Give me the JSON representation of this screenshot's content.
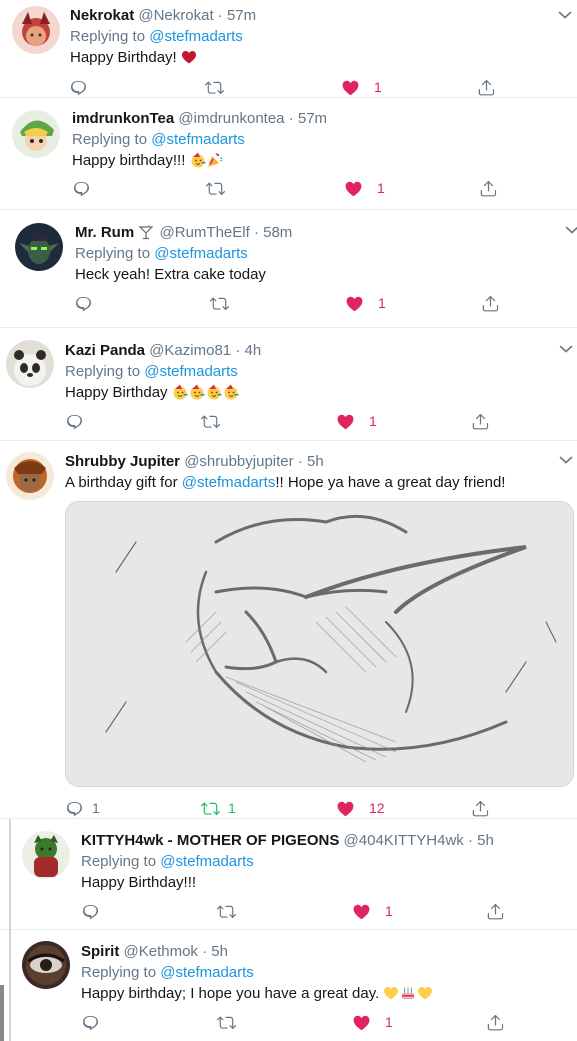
{
  "tweets": [
    {
      "name": "Nekrokat",
      "handle": "@Nekrokat",
      "sep": "·",
      "time": "57m",
      "reply_prefix": "Replying to",
      "reply_to": "@stefmadarts",
      "text": "Happy Birthday!",
      "emoji": [
        "red-heart"
      ],
      "avatar": "nekrokat-avatar",
      "likes": "1",
      "replies": "",
      "retweets": ""
    },
    {
      "name": "imdrunkonTea",
      "handle": "@imdrunkontea",
      "sep": "·",
      "time": "57m",
      "reply_prefix": "Replying to",
      "reply_to": "@stefmadarts",
      "text": "Happy birthday!!!",
      "emoji": [
        "partying-face",
        "party-popper"
      ],
      "avatar": "imdrunkontea-avatar",
      "likes": "1",
      "replies": "",
      "retweets": ""
    },
    {
      "name": "Mr. Rum",
      "name_emoji": "cocktail",
      "handle": "@RumTheElf",
      "sep": "·",
      "time": "58m",
      "reply_prefix": "Replying to",
      "reply_to": "@stefmadarts",
      "text": "Heck yeah! Extra cake today",
      "avatar": "mr-rum-avatar",
      "likes": "1",
      "replies": "",
      "retweets": ""
    },
    {
      "name": "Kazi Panda",
      "handle": "@Kazimo81",
      "sep": "·",
      "time": "4h",
      "reply_prefix": "Replying to",
      "reply_to": "@stefmadarts",
      "text": "Happy Birthday",
      "emoji": [
        "partying-face",
        "partying-face",
        "partying-face",
        "partying-face"
      ],
      "avatar": "kazi-panda-avatar",
      "likes": "1",
      "replies": "",
      "retweets": ""
    },
    {
      "name": "Shrubby Jupiter",
      "handle": "@shrubbyjupiter",
      "sep": "·",
      "time": "5h",
      "text_before": "A birthday gift for",
      "text_mention": "@stefmadarts",
      "text_after": "!! Hope ya have a great day friend!",
      "media": "pencil-sketch-elf-portrait",
      "avatar": "shrubby-jupiter-avatar",
      "likes": "12",
      "replies": "1",
      "retweets": "1"
    },
    {
      "name": "KITTYH4wk - MOTHER OF PIGEONS",
      "handle": "@404KITTYH4wk",
      "sep": "·",
      "time": "5h",
      "reply_prefix": "Replying to",
      "reply_to": "@stefmadarts",
      "text": "Happy Birthday!!!",
      "avatar": "kittyh4wk-avatar",
      "likes": "1",
      "replies": "",
      "retweets": ""
    },
    {
      "name": "Spirit",
      "handle": "@Kethmok",
      "sep": "·",
      "time": "5h",
      "reply_prefix": "Replying to",
      "reply_to": "@stefmadarts",
      "text": "Happy birthday; I hope you have a great day.",
      "emoji": [
        "yellow-heart",
        "birthday-cake",
        "yellow-heart"
      ],
      "avatar": "spirit-avatar",
      "likes": "1",
      "replies": "",
      "retweets": ""
    }
  ],
  "colors": {
    "like": "#e0245e",
    "retweet": "#17bf63",
    "link": "#1b95e0",
    "muted": "#657786"
  },
  "icons": [
    "reply-icon",
    "retweet-icon",
    "like-icon",
    "share-icon",
    "more-chevron-icon"
  ]
}
